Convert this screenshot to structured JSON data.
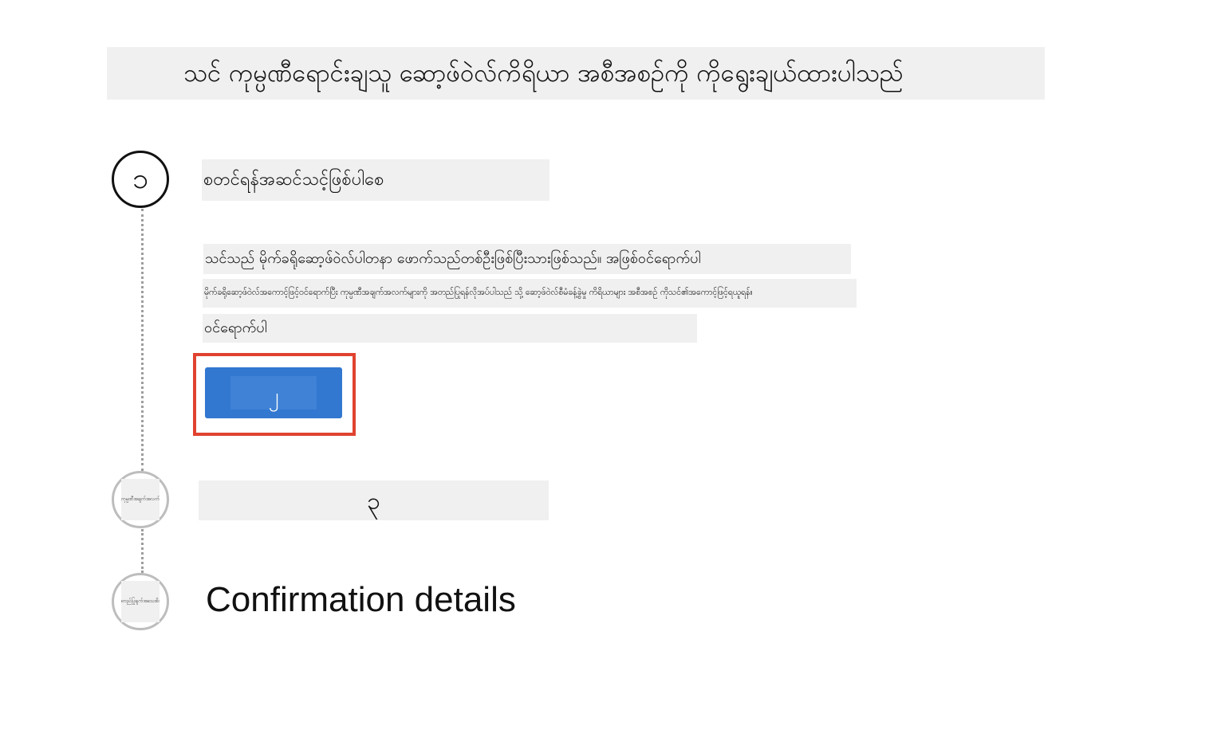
{
  "header": {
    "title": "သင် ကုမ္ပဏီရောင်းချသူ ဆော့ဖ်ဝဲလ်ကိရိယာ အစီအစဉ်ကို ကိုရွေးချယ်ထားပါသည်"
  },
  "steps": [
    {
      "number": "၁",
      "title": "စတင်ရန်အဆင်သင့်ဖြစ်ပါစေ",
      "description_line1": "သင်သည် မိုက်ခရိုဆော့ဖ်ဝဲလ်ပါတနာ ဖောက်သည်တစ်ဦးဖြစ်ပြီးသားဖြစ်သည်။ အဖြစ်ဝင်ရောက်ပါ",
      "description_line2": "မိုက်ခရိုဆော့ဖ်ဝဲလ်အကောင့်ဖြင့်ဝင်ရောက်ပြီး ကုမ္ပဏီအချက်အလက်များကို အတည်ပြုရန်လိုအပ်ပါသည် သို့ ဆော့ဖ်ဝဲလ်စီမံခန့်ခွဲမှု ကိရိယာများ အစီအစဉ် ကိုသင်၏အကောင့်ဖြင့်ရယူရန်။",
      "description_line3": "ဝင်ရောက်ပါ",
      "button_label": "၂"
    },
    {
      "number_label": "ကုမ္ပဏီအချက်အလက်",
      "title": "၃"
    },
    {
      "number_label": "အတည်ပြုချက်အသေးစိတ်",
      "title": "Confirmation details"
    }
  ],
  "colors": {
    "accent_button": "#3277d0",
    "highlight_frame": "#e0432f",
    "placeholder_bg": "#f0f0f0",
    "inactive_circle": "#bdbdbd"
  }
}
